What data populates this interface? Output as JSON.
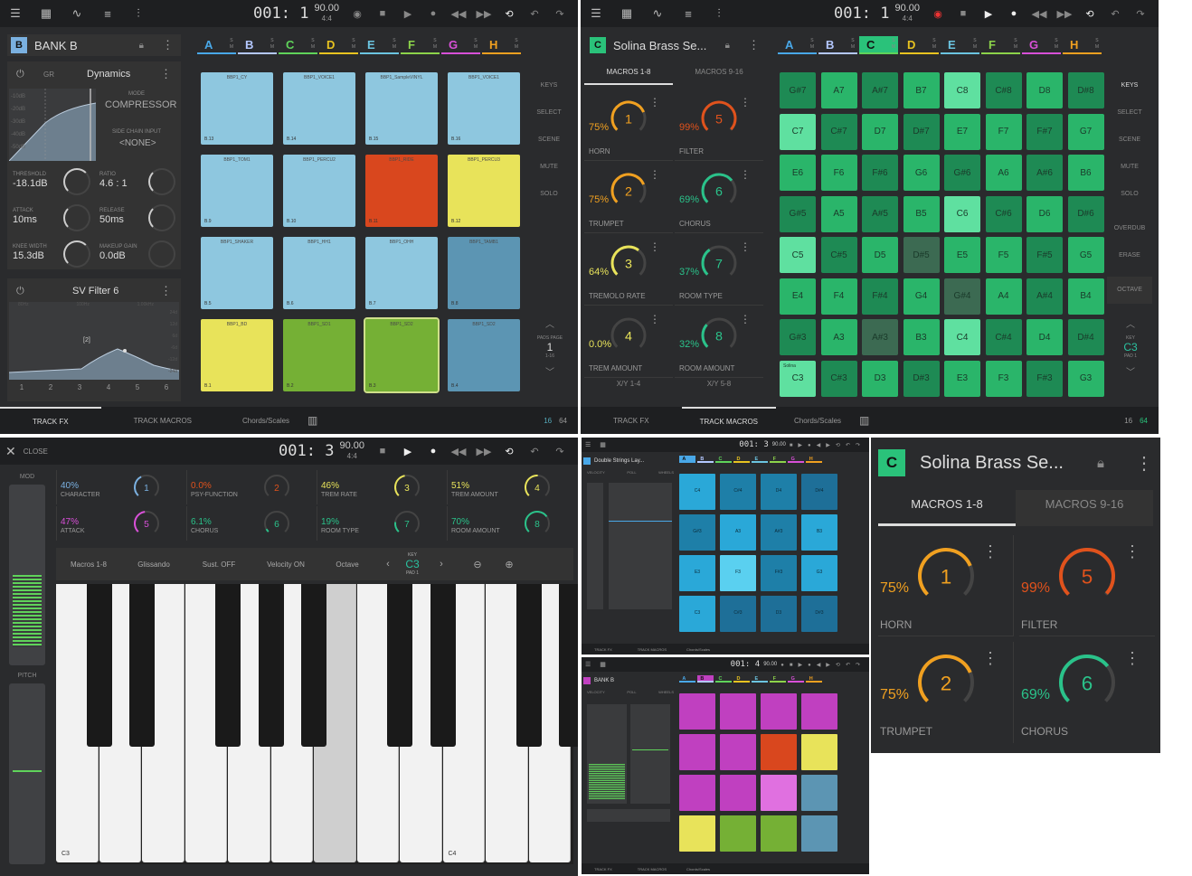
{
  "transport": {
    "p1_position": "001: 1",
    "p2_position": "001: 1",
    "p3_position": "001: 3",
    "p4_position": "001: 3",
    "p5_position": "001: 4",
    "tempo": "90.00",
    "timesig": "4:4"
  },
  "panel1": {
    "track_letter": "B",
    "track_name": "BANK B",
    "dynamics": {
      "title": "Dynamics",
      "gr_label": "GR",
      "mode_label": "MODE",
      "mode_value": "COMPRESSOR",
      "sidechain_label": "SIDE CHAIN INPUT",
      "sidechain_value": "<NONE>",
      "threshold_label": "THRESHOLD",
      "threshold_value": "-18.1dB",
      "ratio_label": "RATIO",
      "ratio_value": "4.6 : 1",
      "attack_label": "ATTACK",
      "attack_value": "10ms",
      "release_label": "RELEASE",
      "release_value": "50ms",
      "knee_label": "KNEE WIDTH",
      "knee_value": "15.3dB",
      "makeup_label": "MAKEUP GAIN",
      "makeup_value": "0.0dB",
      "db_scale": [
        "-10dB",
        "-20dB",
        "-30dB",
        "-40dB",
        "-50dB"
      ]
    },
    "filter": {
      "title": "SV Filter 6",
      "bands": [
        "1",
        "2",
        "3",
        "4",
        "5",
        "6"
      ],
      "freq_labels": [
        "80Hz",
        "100Hz",
        "1.00kHz"
      ],
      "gain_labels": [
        "24d",
        "12d",
        "6d",
        "-6d",
        "-12d",
        "-24d"
      ],
      "node_label": "[2]"
    },
    "banks": [
      {
        "label": "A",
        "color": "#49a8e8"
      },
      {
        "label": "B",
        "color": "#b4c8ff"
      },
      {
        "label": "C",
        "color": "#5fd35a"
      },
      {
        "label": "D",
        "color": "#e8c320"
      },
      {
        "label": "E",
        "color": "#6bc4e0"
      },
      {
        "label": "F",
        "color": "#8cd34a"
      },
      {
        "label": "G",
        "color": "#d850d8"
      },
      {
        "label": "H",
        "color": "#f0a020"
      }
    ],
    "pads": [
      {
        "name": "BBP1_CY",
        "num": "B.13",
        "color": "#8ec7df"
      },
      {
        "name": "BBP1_VOICE1",
        "num": "B.14",
        "color": "#8ec7df"
      },
      {
        "name": "BBP1_SampleVINYL",
        "num": "B.15",
        "color": "#8ec7df"
      },
      {
        "name": "BBP1_VOICE1",
        "num": "B.16",
        "color": "#8ec7df"
      },
      {
        "name": "BBP1_TOM1",
        "num": "B.9",
        "color": "#8ec7df"
      },
      {
        "name": "BBP1_PERCU2",
        "num": "B.10",
        "color": "#8ec7df"
      },
      {
        "name": "BBP1_RIDE",
        "num": "B.11",
        "color": "#d9471e"
      },
      {
        "name": "BBP1_PERCU3",
        "num": "B.12",
        "color": "#e8e35a"
      },
      {
        "name": "BBP1_SHAKER",
        "num": "B.5",
        "color": "#8ec7df"
      },
      {
        "name": "BBP1_HH1",
        "num": "B.6",
        "color": "#8ec7df"
      },
      {
        "name": "BBP1_OHH",
        "num": "B.7",
        "color": "#8ec7df"
      },
      {
        "name": "BBP1_TAMB1",
        "num": "B.8",
        "color": "#5c95b3"
      },
      {
        "name": "BBP1_BD",
        "num": "B.1",
        "color": "#e8e35a"
      },
      {
        "name": "BBP1_SD1",
        "num": "B.2",
        "color": "#75b035"
      },
      {
        "name": "BBP1_SD2",
        "num": "B.3",
        "color": "#75b035"
      },
      {
        "name": "BBP1_SD2",
        "num": "B.4",
        "color": "#5c95b3"
      }
    ],
    "rail": [
      "KEYS",
      "SELECT",
      "SCENE",
      "MUTE",
      "SOLO"
    ],
    "pads_page_label": "PADS PAGE",
    "pads_page_value": "1",
    "pads_page_range": "1-16",
    "bottom": [
      "TRACK FX",
      "TRACK MACROS",
      "Chords/Scales"
    ],
    "page_a": "16",
    "page_b": "64"
  },
  "panel2": {
    "track_letter": "C",
    "track_name": "Solina Brass Se...",
    "tab1": "MACROS 1-8",
    "tab2": "MACROS 9-16",
    "macros": [
      {
        "num": "1",
        "pct": "75%",
        "name": "HORN",
        "color": "#f0a020"
      },
      {
        "num": "5",
        "pct": "99%",
        "name": "FILTER",
        "color": "#e0521c"
      },
      {
        "num": "2",
        "pct": "75%",
        "name": "TRUMPET",
        "color": "#f0a020"
      },
      {
        "num": "6",
        "pct": "69%",
        "name": "CHORUS",
        "color": "#2ac28a"
      },
      {
        "num": "3",
        "pct": "64%",
        "name": "TREMOLO RATE",
        "color": "#e8e35a"
      },
      {
        "num": "7",
        "pct": "37%",
        "name": "ROOM TYPE",
        "color": "#2ac28a"
      },
      {
        "num": "4",
        "pct": "0.0%",
        "name": "TREM AMOUNT",
        "color": "#e8e35a"
      },
      {
        "num": "8",
        "pct": "32%",
        "name": "ROOM AMOUNT",
        "color": "#2ac28a"
      }
    ],
    "xy1": "X/Y 1-4",
    "xy2": "X/Y 5-8",
    "keys": [
      "G#7",
      "A7",
      "A#7",
      "B7",
      "C8",
      "C#8",
      "D8",
      "D#8",
      "C7",
      "C#7",
      "D7",
      "D#7",
      "E7",
      "F7",
      "F#7",
      "G7",
      "E6",
      "F6",
      "F#6",
      "G6",
      "G#6",
      "A6",
      "A#6",
      "B6",
      "G#5",
      "A5",
      "A#5",
      "B5",
      "C6",
      "C#6",
      "D6",
      "D#6",
      "C5",
      "C#5",
      "D5",
      "D#5",
      "E5",
      "F5",
      "F#5",
      "G5",
      "E4",
      "F4",
      "F#4",
      "G4",
      "G#4",
      "A4",
      "A#4",
      "B4",
      "G#3",
      "A3",
      "A#3",
      "B3",
      "C4",
      "C#4",
      "D4",
      "D#4",
      "C3",
      "C#3",
      "D3",
      "D#3",
      "E3",
      "F3",
      "F#3",
      "G3"
    ],
    "root_label": "Solina",
    "rail": [
      "KEYS",
      "SELECT",
      "SCENE",
      "MUTE",
      "SOLO",
      "OVERDUB",
      "ERASE",
      "OCTAVE"
    ],
    "key_label": "KEY",
    "key_value": "C3",
    "pad_label": "PAD 1",
    "bottom": [
      "TRACK FX",
      "TRACK MACROS",
      "Chords/Scales"
    ],
    "page_a": "16",
    "page_b": "64"
  },
  "panel3": {
    "close": "CLOSE",
    "mod": "MOD",
    "pitch": "PITCH",
    "macros": [
      {
        "num": "1",
        "pct": "40%",
        "name": "CHARACTER",
        "color": "#7ab0e0"
      },
      {
        "num": "2",
        "pct": "0.0%",
        "name": "PSY-FUNCTION",
        "color": "#e0521c"
      },
      {
        "num": "3",
        "pct": "46%",
        "name": "TREM RATE",
        "color": "#e8e35a"
      },
      {
        "num": "4",
        "pct": "51%",
        "name": "TREM AMOUNT",
        "color": "#e8e35a"
      },
      {
        "num": "5",
        "pct": "47%",
        "name": "ATTACK",
        "color": "#d850d8"
      },
      {
        "num": "6",
        "pct": "6.1%",
        "name": "CHORUS",
        "color": "#2ac28a"
      },
      {
        "num": "7",
        "pct": "19%",
        "name": "ROOM TYPE",
        "color": "#2ac28a"
      },
      {
        "num": "8",
        "pct": "70%",
        "name": "ROOM AMOUNT",
        "color": "#2ac28a"
      }
    ],
    "toolbar": [
      "Macros 1-8",
      "Glissando",
      "Sust. OFF",
      "Velocity ON",
      "Octave"
    ],
    "key_label": "KEY",
    "key_value": "C3",
    "pad_label": "PAD 1",
    "c3": "C3",
    "c4": "C4"
  },
  "panel4": {
    "track_name": "Double Strings Lay...",
    "tab1": "VELOCITY",
    "tab2": "POLL",
    "tab3": "WHEELS",
    "pads_colors": [
      "#2aa8d8",
      "#1e7fa8",
      "#1e7fa8",
      "#1e6f98",
      "#1e7fa8",
      "#2aa8d8",
      "#1e7fa8",
      "#2aa8d8",
      "#2aa8d8",
      "#5ad0f0",
      "#1e7fa8",
      "#2aa8d8",
      "#2aa8d8",
      "#1e6f98",
      "#1e6f98",
      "#1e6f98"
    ],
    "pad_keys": [
      "C4",
      "C#4",
      "D4",
      "D#4",
      "G#3",
      "A3",
      "A#3",
      "B3",
      "E3",
      "F3",
      "F#3",
      "G3",
      "C3",
      "C#3",
      "D3",
      "D#3"
    ],
    "bottom": [
      "TRACK FX",
      "TRACK MACROS",
      "Chords/Scales"
    ]
  },
  "panel5": {
    "track_name": "BANK B",
    "tab1": "VELOCITY",
    "tab2": "POLL",
    "tab3": "WHEELS",
    "pads_colors": [
      "#c040c0",
      "#c040c0",
      "#c040c0",
      "#c040c0",
      "#c040c0",
      "#c040c0",
      "#d9471e",
      "#e8e35a",
      "#c040c0",
      "#c040c0",
      "#e070e0",
      "#5c95b3",
      "#e8e35a",
      "#75b035",
      "#75b035",
      "#5c95b3"
    ],
    "bottom": [
      "TRACK FX",
      "TRACK MACROS",
      "Chords/Scales"
    ]
  },
  "panel6": {
    "track_letter": "C",
    "track_name": "Solina Brass Se...",
    "tab1": "MACROS 1-8",
    "tab2": "MACROS 9-16",
    "macros": [
      {
        "num": "1",
        "pct": "75%",
        "name": "HORN",
        "color": "#f0a020"
      },
      {
        "num": "5",
        "pct": "99%",
        "name": "FILTER",
        "color": "#e0521c"
      },
      {
        "num": "2",
        "pct": "75%",
        "name": "TRUMPET",
        "color": "#f0a020"
      },
      {
        "num": "6",
        "pct": "69%",
        "name": "CHORUS",
        "color": "#2ac28a"
      }
    ]
  }
}
